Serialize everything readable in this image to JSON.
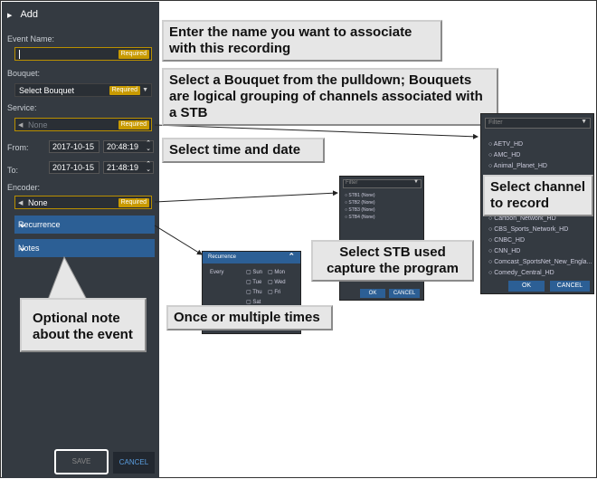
{
  "panel": {
    "title": "Add",
    "event_name_label": "Event Name:",
    "required": "Required",
    "bouquet_label": "Bouquet:",
    "bouquet_value": "Select Bouquet",
    "service_label": "Service:",
    "service_value": "None",
    "from_label": "From:",
    "from_date": "2017-10-15",
    "from_time": "20:48:19",
    "to_label": "To:",
    "to_date": "2017-10-15",
    "to_time": "21:48:19",
    "encoder_label": "Encoder:",
    "encoder_value": "None",
    "recurrence": "Recurrence",
    "notes": "Notes",
    "save": "SAVE",
    "cancel": "CANCEL"
  },
  "callouts": {
    "name": "Enter the name you want to associate with this recording",
    "bouquet": "Select a Bouquet from the pulldown; Bouquets are logical grouping of channels associated with a STB",
    "time": "Select time and date",
    "channel": "Select channel to record",
    "stb": "Select STB used capture the program",
    "recurrence": "Once or multiple times",
    "notes": "Optional note about the event"
  },
  "channel_list": {
    "filter": "Filter",
    "items": [
      "AETV_HD",
      "AMC_HD",
      "Animal_Planet_HD",
      "Cartoon_Network_HD",
      "CBS_Sports_Network_HD",
      "CNBC_HD",
      "CNN_HD",
      "Comcast_SportsNet_New_Engla...",
      "Comedy_Central_HD"
    ],
    "ok": "OK",
    "cancel": "CANCEL"
  },
  "stb_list": {
    "filter": "Filter",
    "items": [
      "STB1 (None)",
      "STB2 (None)",
      "STB3 (None)",
      "STB4 (None)"
    ],
    "ok": "OK",
    "cancel": "CANCEL"
  },
  "recurrence_popup": {
    "title": "Recurrence",
    "every": "Every",
    "days": [
      "Sun",
      "Mon",
      "Tue",
      "Wed",
      "Thu",
      "Fri",
      "Sat"
    ]
  }
}
